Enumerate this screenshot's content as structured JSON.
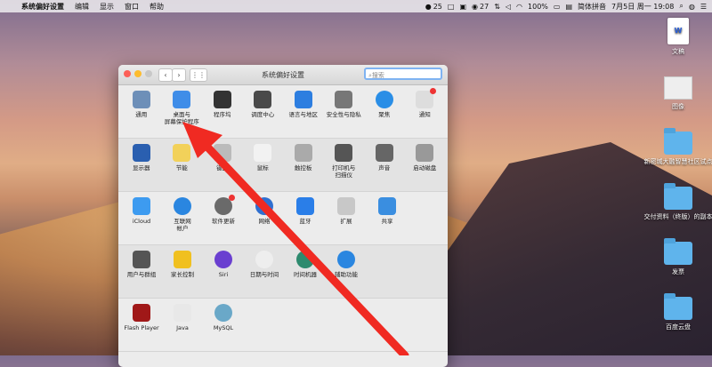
{
  "menubar": {
    "app": "系统偏好设置",
    "items": [
      "编辑",
      "显示",
      "窗口",
      "帮助"
    ],
    "wechat_count": "25",
    "pay_count": "27",
    "battery": "100%",
    "input_method": "简体拼音",
    "clock": "7月5日 周一 19:08"
  },
  "desktop": {
    "icons": [
      {
        "label": "文稿"
      },
      {
        "label": "图像"
      },
      {
        "label": "新密城大融智慧社区试点"
      },
      {
        "label": "交付资料（终版）的副本"
      },
      {
        "label": "发票"
      },
      {
        "label": "百度云盘"
      }
    ]
  },
  "window": {
    "title": "系统偏好设置",
    "search_placeholder": "搜索",
    "rows": [
      [
        {
          "label": "通用",
          "icon": "general-icon",
          "color": "#6d8fb8"
        },
        {
          "label": "桌面与\n屏幕保护程序",
          "icon": "desktop-screensaver-icon",
          "color": "#3f8de8"
        },
        {
          "label": "程序坞",
          "icon": "dock-icon",
          "color": "#333333"
        },
        {
          "label": "调度中心",
          "icon": "mission-control-icon",
          "color": "#4a4a4a"
        },
        {
          "label": "语言与地区",
          "icon": "language-region-icon",
          "color": "#2d7ee0"
        },
        {
          "label": "安全性与隐私",
          "icon": "security-icon",
          "color": "#777777"
        },
        {
          "label": "聚焦",
          "icon": "spotlight-icon",
          "color": "#2a8ee6"
        },
        {
          "label": "通知",
          "icon": "notifications-icon",
          "color": "#dddddd"
        }
      ],
      [
        {
          "label": "显示器",
          "icon": "display-icon",
          "color": "#2a5fb0"
        },
        {
          "label": "节能",
          "icon": "energy-saver-icon",
          "color": "#f2d15a"
        },
        {
          "label": "键盘",
          "icon": "keyboard-icon",
          "color": "#bbbbbb"
        },
        {
          "label": "鼠标",
          "icon": "mouse-icon",
          "color": "#f2f2f2"
        },
        {
          "label": "触控板",
          "icon": "trackpad-icon",
          "color": "#aaaaaa"
        },
        {
          "label": "打印机与\n扫描仪",
          "icon": "printer-icon",
          "color": "#555555"
        },
        {
          "label": "声音",
          "icon": "sound-icon",
          "color": "#666666"
        },
        {
          "label": "启动磁盘",
          "icon": "startup-disk-icon",
          "color": "#999999"
        }
      ],
      [
        {
          "label": "iCloud",
          "icon": "icloud-icon",
          "color": "#3d9bf0"
        },
        {
          "label": "互联网\n帐户",
          "icon": "internet-accounts-icon",
          "color": "#2a86e0"
        },
        {
          "label": "软件更新",
          "icon": "software-update-icon",
          "color": "#6a6a6a"
        },
        {
          "label": "网络",
          "icon": "network-icon",
          "color": "#2f6fd0"
        },
        {
          "label": "蓝牙",
          "icon": "bluetooth-icon",
          "color": "#2a7ee8"
        },
        {
          "label": "扩展",
          "icon": "extensions-icon",
          "color": "#c8c8c8"
        },
        {
          "label": "共享",
          "icon": "sharing-icon",
          "color": "#3a8ee0"
        }
      ],
      [
        {
          "label": "用户与群组",
          "icon": "users-groups-icon",
          "color": "#555555"
        },
        {
          "label": "家长控制",
          "icon": "parental-controls-icon",
          "color": "#f0c020"
        },
        {
          "label": "Siri",
          "icon": "siri-icon",
          "color": "#6a3fd0"
        },
        {
          "label": "日期与时间",
          "icon": "date-time-icon",
          "color": "#eeeeee"
        },
        {
          "label": "时间机器",
          "icon": "time-machine-icon",
          "color": "#2d8a6e"
        },
        {
          "label": "辅助功能",
          "icon": "accessibility-icon",
          "color": "#2a86e0"
        }
      ],
      [
        {
          "label": "Flash Player",
          "icon": "flash-player-icon",
          "color": "#a01818"
        },
        {
          "label": "Java",
          "icon": "java-icon",
          "color": "#e8e8e8"
        },
        {
          "label": "MySQL",
          "icon": "mysql-icon",
          "color": "#6aa8c8"
        }
      ]
    ]
  },
  "annotation": {
    "arrow_color": "#f02a22"
  }
}
